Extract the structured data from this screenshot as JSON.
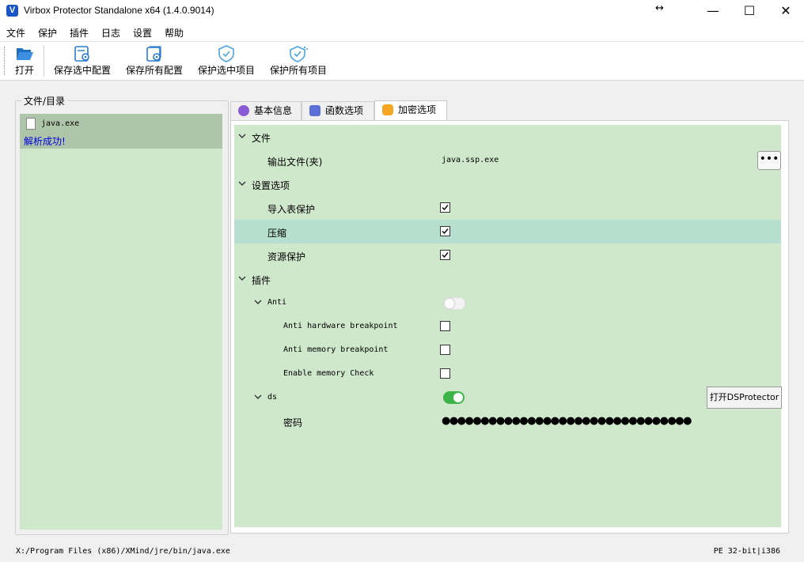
{
  "window": {
    "logo_letter": "V",
    "title": "Virbox Protector Standalone x64  (1.4.0.9014)",
    "controls": {
      "minimize": "—",
      "maximize": "☐",
      "close": "✕"
    }
  },
  "menu": {
    "items": [
      "文件",
      "保护",
      "插件",
      "日志",
      "设置",
      "帮助"
    ]
  },
  "toolbar": {
    "buttons": [
      {
        "label": "打开",
        "icon": "folder-open-icon"
      },
      {
        "label": "保存选中配置",
        "icon": "save-config-icon"
      },
      {
        "label": "保存所有配置",
        "icon": "save-all-config-icon"
      },
      {
        "label": "保护选中项目",
        "icon": "shield-icon"
      },
      {
        "label": "保护所有项目",
        "icon": "shield-all-icon"
      }
    ]
  },
  "left_panel": {
    "title": "文件/目录",
    "files": [
      {
        "name": "java.exe",
        "status": "解析成功!"
      }
    ]
  },
  "tabs": [
    {
      "label": "基本信息",
      "icon": "chat-icon",
      "active": false
    },
    {
      "label": "函数选项",
      "icon": "function-icon",
      "active": false
    },
    {
      "label": "加密选项",
      "icon": "lock-icon",
      "active": true
    }
  ],
  "options": {
    "file_section": "文件",
    "output_label": "输出文件(夹)",
    "output_value": "java.ssp.exe",
    "more_button": "•••",
    "settings_section": "设置选项",
    "import_protect": {
      "label": "导入表保护",
      "checked": true
    },
    "compress": {
      "label": "压缩",
      "checked": true
    },
    "resource_protect": {
      "label": "资源保护",
      "checked": true
    },
    "plugins_section": "插件",
    "anti": {
      "label": "Anti",
      "enabled": false
    },
    "anti_hw": {
      "label": "Anti hardware breakpoint",
      "checked": false
    },
    "anti_mem": {
      "label": "Anti memory breakpoint",
      "checked": false
    },
    "mem_check": {
      "label": "Enable memory Check",
      "checked": false
    },
    "ds": {
      "label": "ds",
      "enabled": true,
      "button": "打开DSProtector"
    },
    "password": {
      "label": "密码",
      "value": "●●●●●●●●●●●●●●●●●●●●●●●●●●●●●●●●"
    }
  },
  "status": {
    "path": "X:/Program Files (x86)/XMind/jre/bin/java.exe",
    "arch": "PE 32-bit|i386"
  },
  "colors": {
    "panel_bg": "#cfe8cc",
    "selected_row": "#b7dfcf",
    "file_item_bg": "#aec5a9",
    "toggle_on": "#3cb44a",
    "link_blue": "#0000e0"
  }
}
